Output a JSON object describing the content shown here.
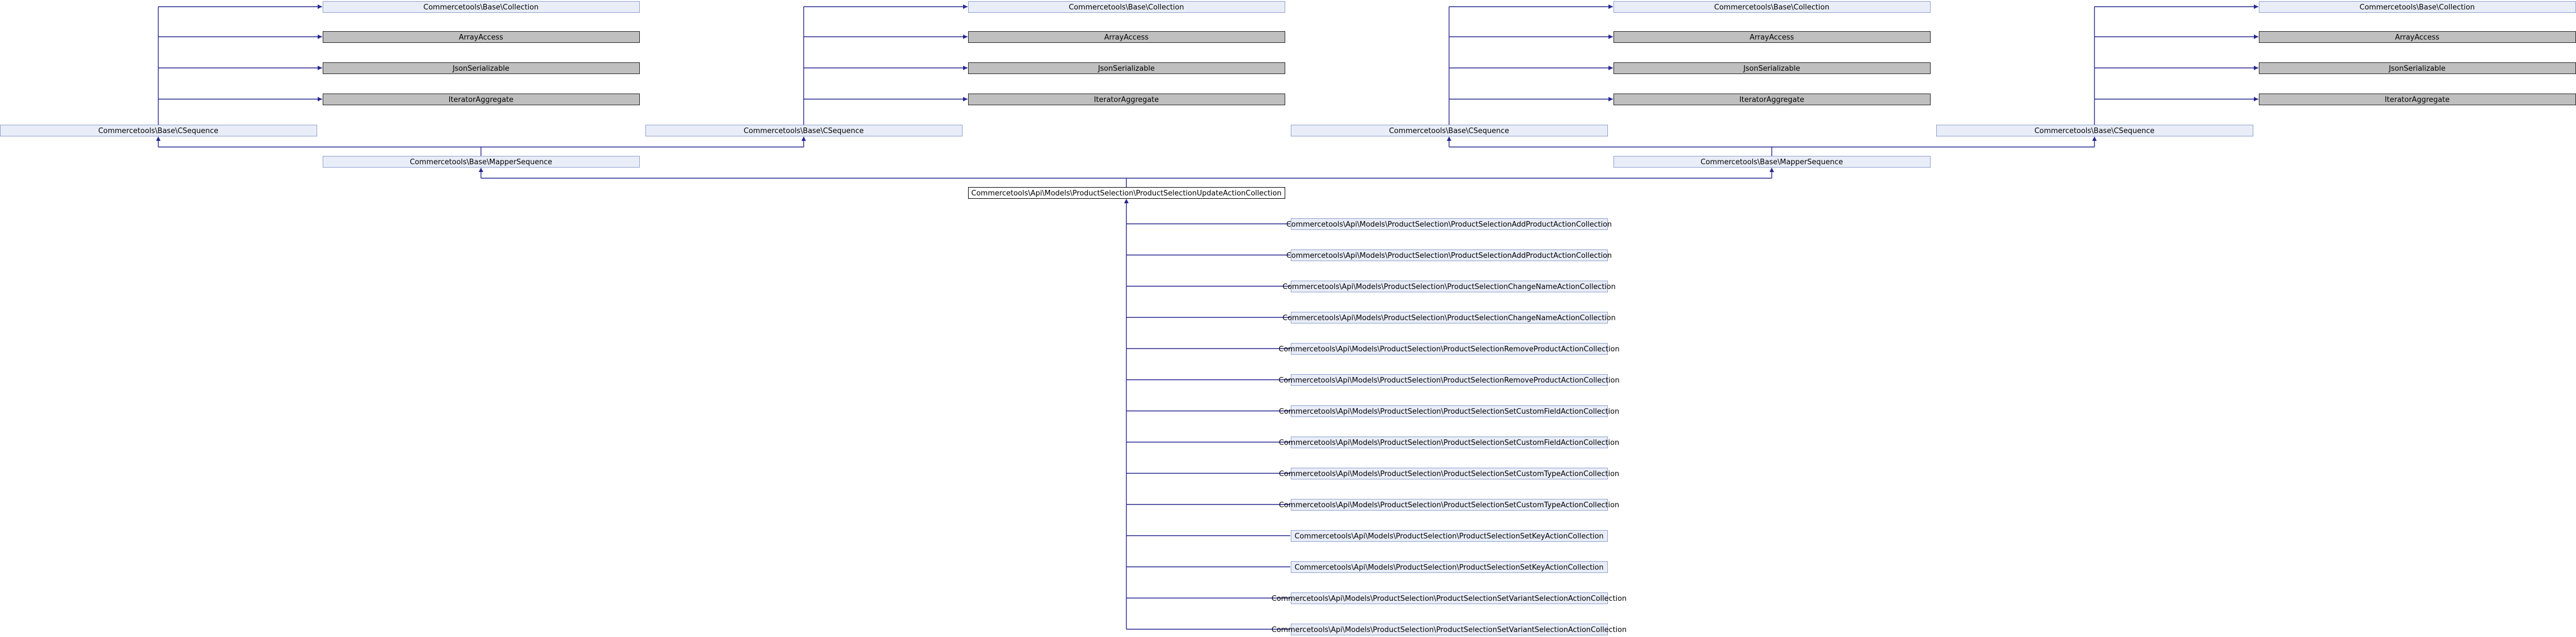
{
  "colors": {
    "edge": "#25258f",
    "box_light": "#e8edf8",
    "box_light_border": "#8ea0cc",
    "box_grey": "#bfbfbf",
    "box_grey_border": "#222222",
    "box_focus": "#ffffff",
    "box_focus_border": "#000000"
  },
  "labels": {
    "collection": "Commercetools\\Base\\Collection",
    "array_access": "ArrayAccess",
    "json_serializable": "JsonSerializable",
    "iterator_aggregate": "IteratorAggregate",
    "csequence": "Commercetools\\Base\\CSequence",
    "mapper_sequence": "Commercetools\\Base\\MapperSequence",
    "focus": "Commercetools\\Api\\Models\\ProductSelection\\ProductSelectionUpdateActionCollection",
    "add_product": "Commercetools\\Api\\Models\\ProductSelection\\ProductSelectionAddProductActionCollection",
    "change_name": "Commercetools\\Api\\Models\\ProductSelection\\ProductSelectionChangeNameActionCollection",
    "remove_product": "Commercetools\\Api\\Models\\ProductSelection\\ProductSelectionRemoveProductActionCollection",
    "set_custom_field": "Commercetools\\Api\\Models\\ProductSelection\\ProductSelectionSetCustomFieldActionCollection",
    "set_custom_type": "Commercetools\\Api\\Models\\ProductSelection\\ProductSelectionSetCustomTypeActionCollection",
    "set_key": "Commercetools\\Api\\Models\\ProductSelection\\ProductSelectionSetKeyActionCollection",
    "set_variant_selection": "Commercetools\\Api\\Models\\ProductSelection\\ProductSelectionSetVariantSelectionActionCollection"
  }
}
